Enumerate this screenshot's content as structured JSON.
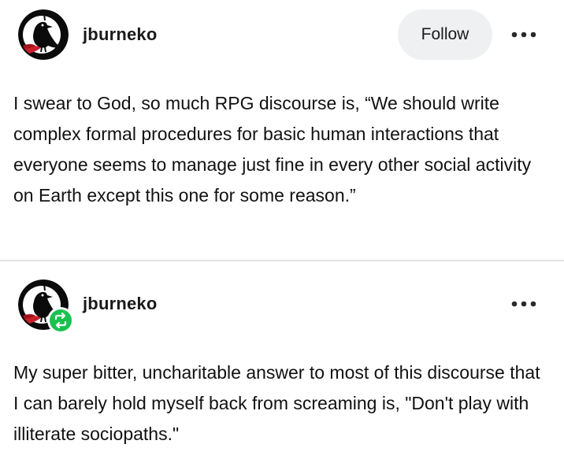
{
  "post": {
    "author": "jburneko",
    "follow_label": "Follow",
    "body": "I swear to God, so much RPG discourse is, “We should write complex formal procedures for basic human interactions that everyone seems to manage just fine in every other social activity on Earth except this one for some reason.”"
  },
  "reblog": {
    "author": "jburneko",
    "body": "My super bitter, uncharitable answer to most of this discourse that I can barely hold myself back from screaming is, \"Don't play with illiterate sociopaths.\""
  },
  "icons": {
    "more": "more-horizontal-icon",
    "reblog": "reblog-icon"
  },
  "colors": {
    "follow_bg": "#eef0f2",
    "reblog_badge": "#19c24f",
    "avatar_red": "#c8202a",
    "text": "#111111"
  }
}
